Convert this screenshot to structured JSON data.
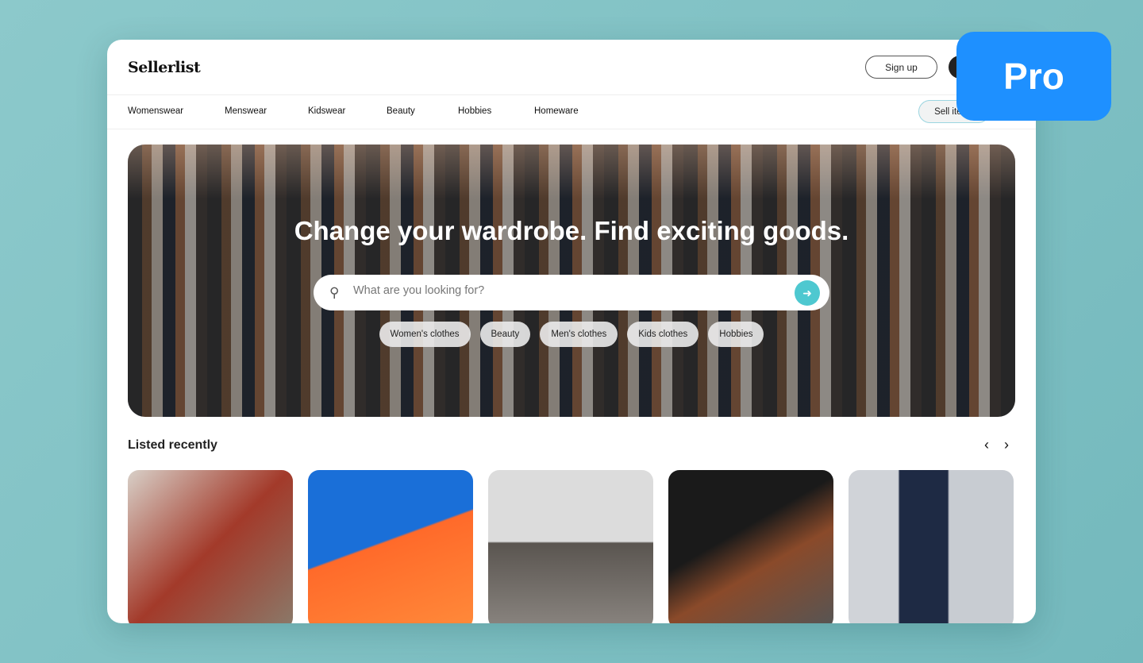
{
  "header": {
    "logo": "Sellerlist",
    "signup": "Sign up"
  },
  "nav": {
    "items": [
      "Womenswear",
      "Menswear",
      "Kidswear",
      "Beauty",
      "Hobbies",
      "Homeware"
    ],
    "sell": "Sell items"
  },
  "hero": {
    "title": "Change your wardrobe. Find exciting goods.",
    "search_placeholder": "What are you looking for?",
    "chips": [
      "Women's clothes",
      "Beauty",
      "Men's clothes",
      "Kids clothes",
      "Hobbies"
    ]
  },
  "listed": {
    "title": "Listed recently",
    "prev": "‹",
    "next": "›"
  },
  "badge": {
    "label": "Pro",
    "color": "#1e90ff"
  },
  "accent": "#4ec8d0"
}
